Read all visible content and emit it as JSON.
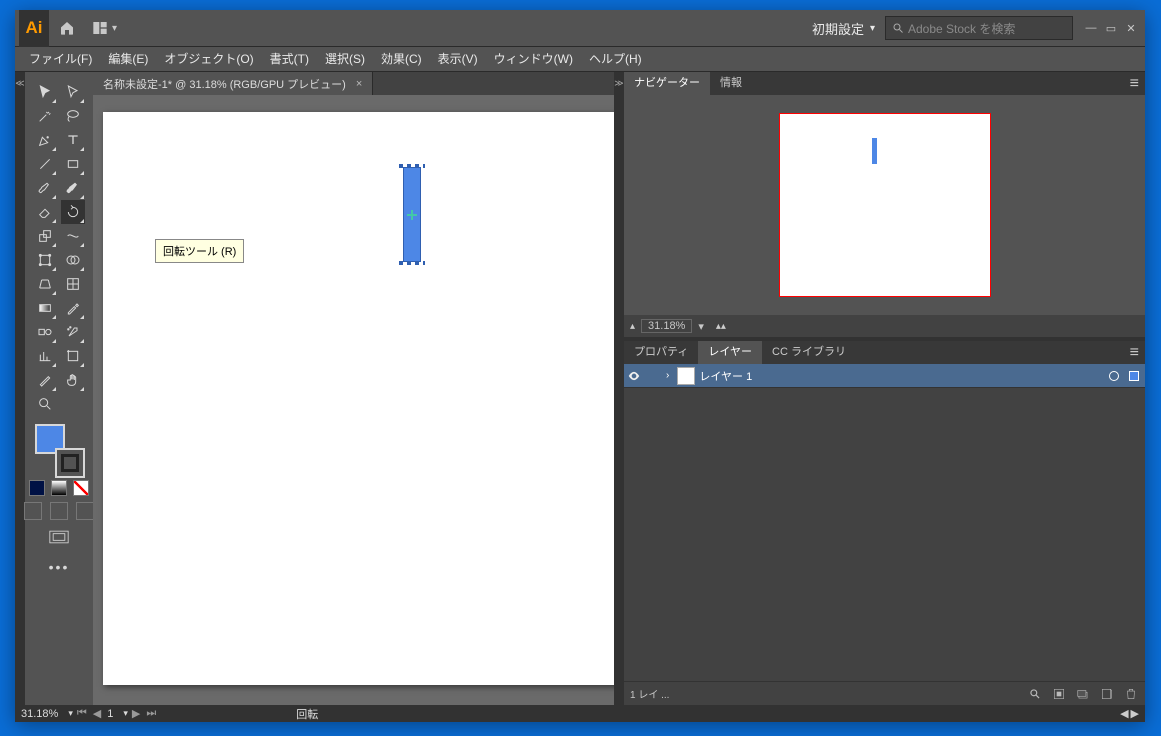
{
  "titlebar": {
    "logo": "Ai",
    "workspace": "初期設定",
    "search_placeholder": "Adobe Stock を検索"
  },
  "menu": [
    "ファイル(F)",
    "編集(E)",
    "オブジェクト(O)",
    "書式(T)",
    "選択(S)",
    "効果(C)",
    "表示(V)",
    "ウィンドウ(W)",
    "ヘルプ(H)"
  ],
  "doctab": {
    "label": "名称未設定-1* @ 31.18% (RGB/GPU プレビュー)"
  },
  "tooltip": "回転ツール (R)",
  "status": {
    "zoom": "31.18%",
    "page": "1",
    "tool": "回転"
  },
  "panels": {
    "navigator": "ナビゲーター",
    "info": "情報",
    "zoom": "31.18%",
    "properties": "プロパティ",
    "layers": "レイヤー",
    "cclib": "CC ライブラリ"
  },
  "layer": {
    "name": "レイヤー 1"
  },
  "layers_foot": {
    "count": "1 レイ ..."
  }
}
